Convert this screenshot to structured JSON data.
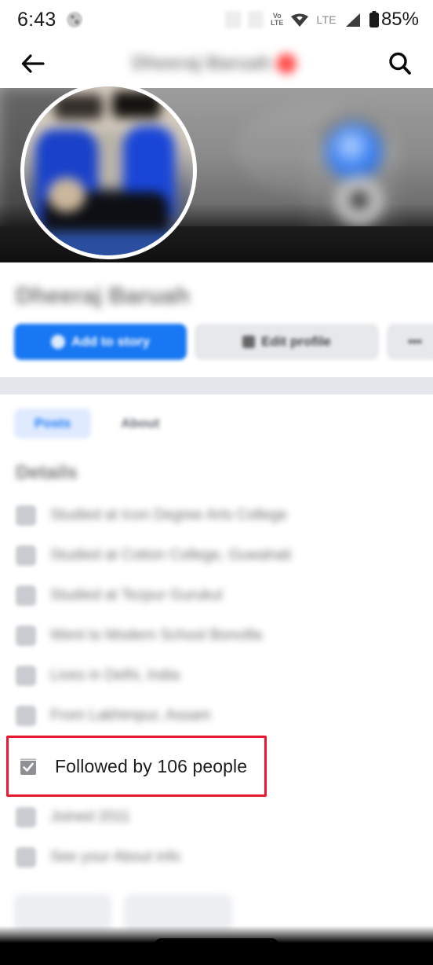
{
  "status_bar": {
    "time": "6:43",
    "status_icon": "cast-icon",
    "volte_line1": "Vo",
    "volte_line2": "LTE",
    "network_label": "LTE",
    "battery_percent": "85%",
    "icons": [
      "placeholder-icon",
      "placeholder-icon",
      "volte-icon",
      "wifi-icon",
      "lte-icon",
      "signal-icon",
      "battery-icon"
    ]
  },
  "app_bar": {
    "back_icon": "back-arrow-icon",
    "title": "Dheeraj Baruah",
    "title_badge": "flag-badge",
    "search_icon": "search-icon"
  },
  "profile": {
    "cover_photo_alt": "cover-photo",
    "avatar_alt": "profile-photo",
    "name": "Dheeraj Baruah"
  },
  "actions": {
    "primary_label": "Add to story",
    "primary_icon": "plus-circle-icon",
    "primary_color": "#1877f2",
    "secondary_label": "Edit profile",
    "secondary_icon": "pencil-icon",
    "more_label": "•••",
    "more_icon": "ellipsis-icon"
  },
  "tabs": [
    {
      "label": "Posts",
      "active": true
    },
    {
      "label": "About",
      "active": false
    }
  ],
  "details": {
    "heading": "Details",
    "rows": [
      {
        "icon": "graduation-cap-icon",
        "text": "Studied at Icon Degree Arts College",
        "highlight": false
      },
      {
        "icon": "graduation-cap-icon",
        "text": "Studied at Cotton College, Guwahati",
        "highlight": false
      },
      {
        "icon": "graduation-cap-icon",
        "text": "Studied at Tezpur Gurukul",
        "highlight": false
      },
      {
        "icon": "school-icon",
        "text": "Went to Modern School Bonvilla",
        "highlight": false
      },
      {
        "icon": "location-pin-icon",
        "text": "Lives in Delhi, India",
        "highlight": false
      },
      {
        "icon": "home-icon",
        "text": "From Lakhimpur, Assam",
        "highlight": false
      },
      {
        "icon": "followed-check-icon",
        "text": "Followed by 106 people",
        "highlight": true,
        "highlight_color": "#e8192c"
      },
      {
        "icon": "clock-icon",
        "text": "Joined 2011",
        "highlight": false
      },
      {
        "icon": "info-icon",
        "text": "See your About info",
        "highlight": false
      }
    ]
  },
  "bottom_chips": [
    {
      "label": ""
    },
    {
      "label": ""
    }
  ],
  "nav_bar": {
    "type": "gesture-nav-bar",
    "color": "#000000"
  }
}
